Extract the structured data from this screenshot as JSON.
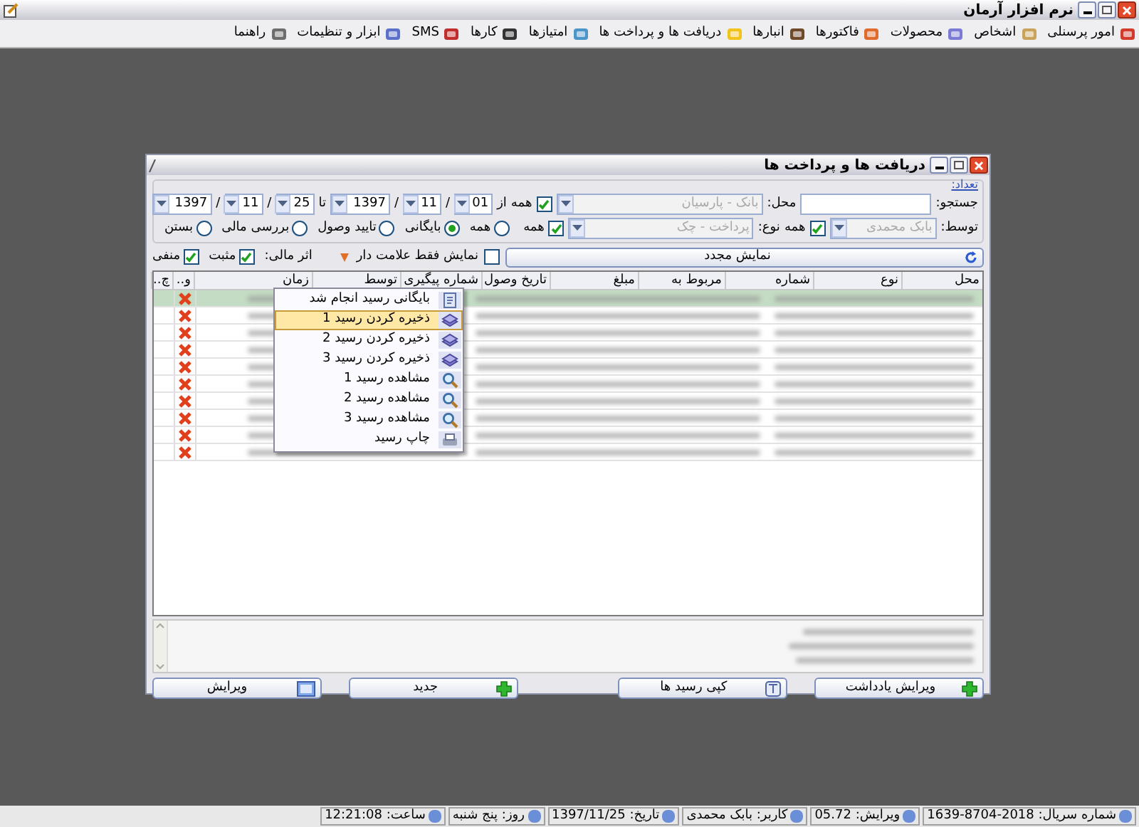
{
  "app": {
    "title": "نرم افزار آرمان"
  },
  "menu": [
    {
      "label": "امور پرسنلی"
    },
    {
      "label": "اشخاص"
    },
    {
      "label": "محصولات"
    },
    {
      "label": "فاکتورها"
    },
    {
      "label": "انبارها"
    },
    {
      "label": "دریافت ها و پرداخت ها"
    },
    {
      "label": "امتیازها"
    },
    {
      "label": "کارها"
    },
    {
      "label": "SMS"
    },
    {
      "label": "ابزار و تنظیمات"
    },
    {
      "label": "راهنما"
    }
  ],
  "dialog": {
    "title": "دریافت ها و پرداخت ها",
    "count_link": "تعداد:",
    "search": {
      "label": "جستجو:"
    },
    "location": {
      "label": "محل:",
      "value": "بانک - پارسیان",
      "disabled": true
    },
    "location_all": {
      "label": "همه",
      "checked": true
    },
    "date_from": {
      "label": "از",
      "day": "01",
      "separators": [
        "/",
        "/"
      ],
      "month": "11",
      "year": "1397"
    },
    "date_to": {
      "label": "تا",
      "day": "25",
      "separators": [
        "/",
        "/"
      ],
      "month": "11",
      "year": "1397"
    },
    "by": {
      "label": "توسط:",
      "value": "بابک محمدی",
      "disabled": true
    },
    "by_all": {
      "label": "همه",
      "checked": true
    },
    "type": {
      "label": "نوع:",
      "value": "پرداخت - چک",
      "disabled": true
    },
    "type_all": {
      "label": "همه",
      "checked": true
    },
    "status_radios": [
      {
        "label": "همه",
        "selected": false
      },
      {
        "label": "بایگانی",
        "selected": true
      },
      {
        "label": "تایید وصول",
        "selected": false
      },
      {
        "label": "بررسی مالی",
        "selected": false
      },
      {
        "label": "بستن",
        "selected": false
      }
    ],
    "refresh_button": "نمایش مجدد",
    "flagged_only": {
      "label": "نمایش فقط علامت دار",
      "checked": false
    },
    "financial_effect": {
      "label": "اثر مالی:",
      "options": [
        {
          "label": "مثبت",
          "checked": true
        },
        {
          "label": "منفی",
          "checked": true
        }
      ]
    },
    "table": {
      "columns": [
        "محل",
        "نوع",
        "شماره",
        "مربوط به",
        "مبلغ",
        "تاریخ وصول",
        "شماره پیگیری",
        "توسط",
        "زمان",
        "و..",
        "چ.."
      ],
      "rows": [
        {
          "selected": true
        },
        {
          "selected": false
        },
        {
          "selected": false
        },
        {
          "selected": false
        },
        {
          "selected": false
        },
        {
          "selected": false
        },
        {
          "selected": false
        },
        {
          "selected": false
        },
        {
          "selected": false
        },
        {
          "selected": false
        }
      ]
    },
    "context_menu": [
      {
        "label": "بایگانی رسید انجام شد",
        "kind": "archive",
        "selected": false
      },
      {
        "label": "ذخیره کردن رسید 1",
        "kind": "save",
        "selected": true
      },
      {
        "label": "ذخیره کردن رسید 2",
        "kind": "save",
        "selected": false
      },
      {
        "label": "ذخیره کردن رسید 3",
        "kind": "save",
        "selected": false
      },
      {
        "label": "مشاهده رسید 1",
        "kind": "view",
        "selected": false
      },
      {
        "label": "مشاهده رسید 2",
        "kind": "view",
        "selected": false
      },
      {
        "label": "مشاهده رسید 3",
        "kind": "view",
        "selected": false
      },
      {
        "label": "چاپ رسید",
        "kind": "print",
        "selected": false
      }
    ],
    "buttons": [
      {
        "label": "ویرایش یادداشت",
        "kind": "add"
      },
      {
        "label": "کپی رسید ها",
        "kind": "copy"
      },
      {
        "label": "جدید",
        "kind": "add"
      },
      {
        "label": "ویرایش",
        "kind": "edit"
      }
    ]
  },
  "status_bar": [
    "شماره سریال: 2018-8704-1639",
    "ویرایش: 05.72",
    "کاربر: بابک محمدی",
    "تاریخ: 1397/11/25",
    "روز: پنج شنبه",
    "ساعت: 12:21:08"
  ]
}
